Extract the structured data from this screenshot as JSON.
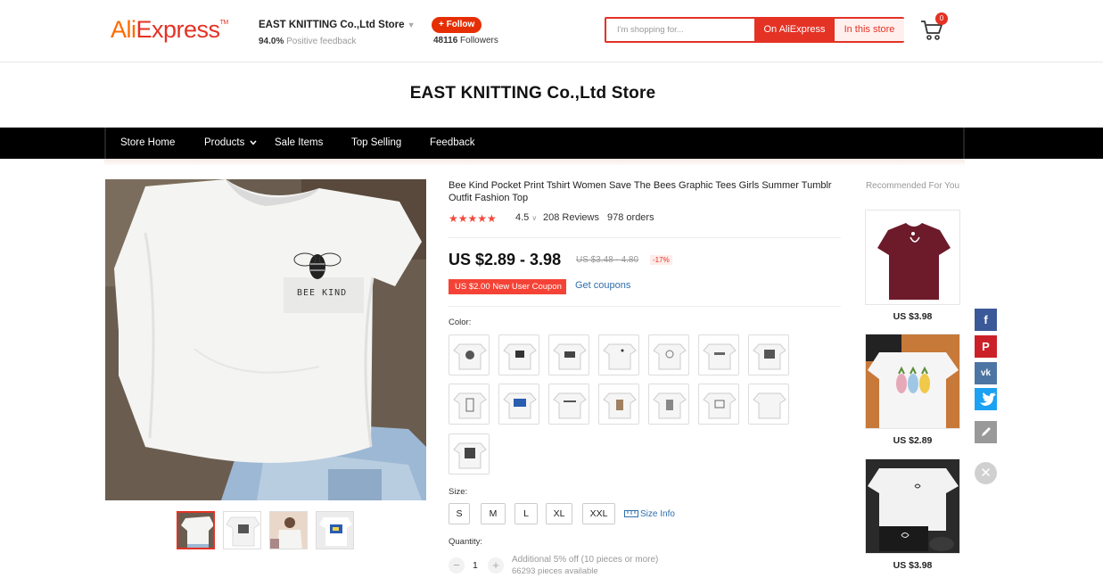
{
  "header": {
    "logo_ali": "Ali",
    "logo_express": "Express",
    "logo_tm": "TM",
    "store_name": "EAST KNITTING Co.,Ltd Store",
    "feedback_pct": "94.0%",
    "feedback_label": "Positive feedback",
    "follow_label": "+ Follow",
    "followers_count": "48116",
    "followers_label": "Followers",
    "search_placeholder": "I'm shopping for...",
    "search_on_ali": "On AliExpress",
    "search_in_store": "In this store",
    "cart_count": "0"
  },
  "banner": {
    "title": "EAST KNITTING Co.,Ltd Store"
  },
  "nav": {
    "items": [
      "Store Home",
      "Products",
      "Sale Items",
      "Top Selling",
      "Feedback"
    ]
  },
  "product": {
    "title": "Bee Kind Pocket Print Tshirt Women Save The Bees Graphic Tees Girls Summer Tumblr Outfit Fashion Top",
    "stars": "★★★★★",
    "rating": "4.5",
    "reviews": "208 Reviews",
    "orders": "978 orders",
    "price": "US $2.89 - 3.98",
    "old_price": "US $3.48 - 4.80",
    "discount": "-17%",
    "coupon": "US $2.00 New User Coupon",
    "get_coupons": "Get coupons",
    "print_text": "BEE KIND",
    "color_label": "Color:",
    "size_label": "Size:",
    "sizes": [
      "S",
      "M",
      "L",
      "XL",
      "XXL"
    ],
    "size_info": "Size Info",
    "quantity_label": "Quantity:",
    "quantity": "1",
    "qty_note": "Additional 5% off (10 pieces or more)",
    "available": "66293 pieces available"
  },
  "recommended": {
    "heading": "Recommended For You",
    "items": [
      {
        "price": "US $3.98"
      },
      {
        "price": "US $2.89"
      },
      {
        "price": "US $3.98"
      }
    ]
  },
  "share": {
    "facebook": "f",
    "pinterest": "P",
    "vk": "vk"
  },
  "colors": {
    "accent": "#e43225",
    "brand_orange": "#ff6a00",
    "link": "#2e6ead",
    "facebook": "#3b5998",
    "pinterest": "#cb2027",
    "vk": "#4c75a3",
    "twitter": "#1da1f2"
  }
}
